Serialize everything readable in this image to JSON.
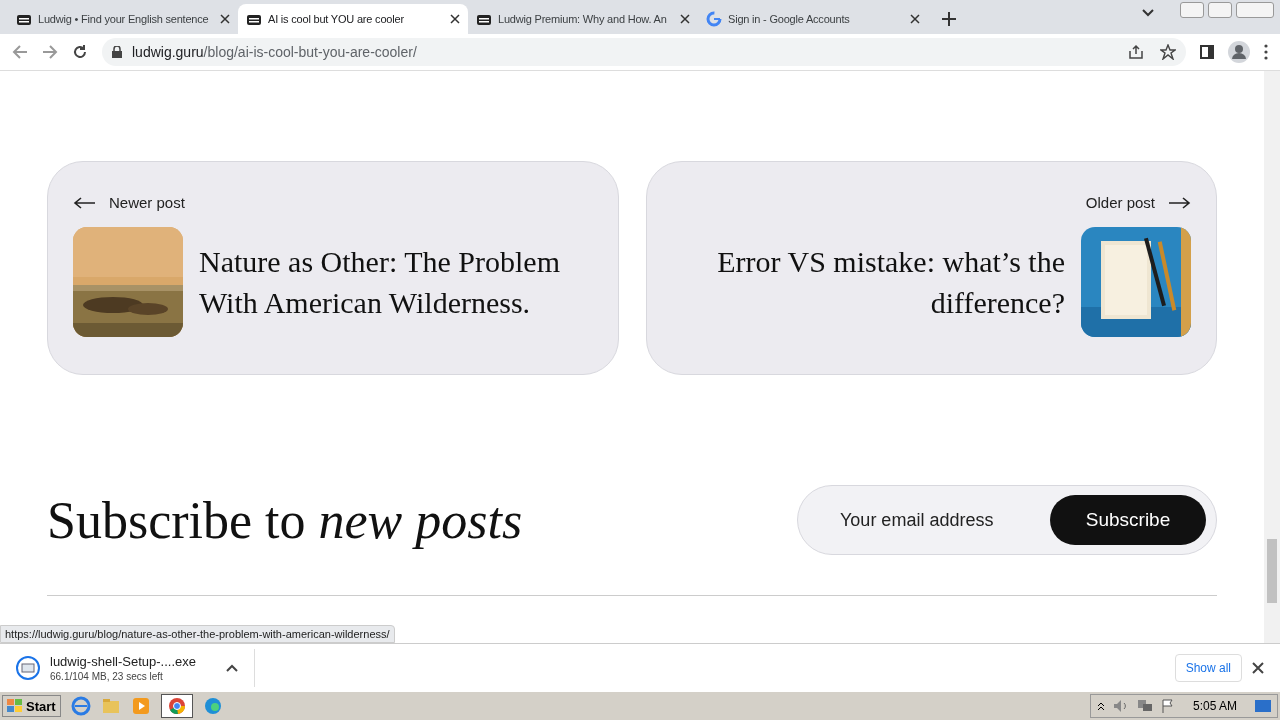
{
  "tabs": [
    {
      "title": "Ludwig • Find your English sentence",
      "selected": false
    },
    {
      "title": "AI is cool but YOU are cooler",
      "selected": true
    },
    {
      "title": "Ludwig Premium: Why and How. An",
      "selected": false
    },
    {
      "title": "Sign in - Google Accounts",
      "selected": false
    }
  ],
  "address_bar": {
    "domain": "ludwig.guru",
    "path": "/blog/ai-is-cool-but-you-are-cooler/"
  },
  "post_nav": [
    {
      "kind": "newer",
      "label": "Newer post",
      "title": "Nature as Other: The Problem With American Wilderness."
    },
    {
      "kind": "older",
      "label": "Older post",
      "title": "Error VS mistake: what’s the difference?"
    }
  ],
  "subscribe": {
    "heading": "Subscribe to ",
    "heading_italic": "new posts",
    "placeholder": "Your email address",
    "button": "Subscribe"
  },
  "status_url": "https://ludwig.guru/blog/nature-as-other-the-problem-with-american-wilderness/",
  "download": {
    "filename": "ludwig-shell-Setup-....exe",
    "progress": "66.1/104 MB, 23 secs left",
    "show_all": "Show all"
  },
  "taskbar": {
    "start": "Start",
    "time": "5:05 AM"
  }
}
